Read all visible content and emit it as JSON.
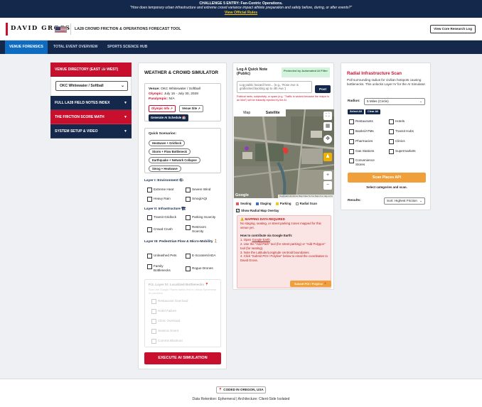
{
  "banner": {
    "line1": "CHALLENGE 5 ENTRY: Fan-Centric Operations.",
    "line2": "\"How does temporary urban infrastructure and extreme crowd variance impact athlete preparation and safety before, during, or after events?\"",
    "link": "View Official Rules"
  },
  "header": {
    "logo": "DAVID GROSS",
    "title": "LA28 CROWD FRICTION & OPERATIONS FORECAST TOOL",
    "research_log": "View Core Research Log"
  },
  "nav": {
    "tabs": [
      "VENUE FORENSICS",
      "TOTAL EVENT OVERVIEW",
      "SPORTS SCIENCE HUB"
    ]
  },
  "left": {
    "directory": "VENUE DIRECTORY (EAST 🇺🇸 WEST)",
    "selected_venue": "OKC Whitewater / Softball",
    "items": [
      "FULL LA28 FIELD NOTES INDEX",
      "THE FRICTION SCORE MATH",
      "SYSTEM SETUP & VIDEO"
    ]
  },
  "weather": {
    "title": "WEATHER & CROWD SIMULATOR",
    "venue_label": "Venue:",
    "venue": "OKC Whitewater / Softball",
    "olympic_label": "Olympic:",
    "olympic": "July 15 - July 30, 2028",
    "para_label": "Paralympic:",
    "para": "N/A",
    "olympic_info": "Olympic Info ↗",
    "venue_site": "Venue Site ↗",
    "gen_schedule": "Generate AI Schedule 📅",
    "quick_label": "Quick Scenarios:",
    "scenarios": [
      "Heatwave + Gridlock",
      "Storm + Flow Bottleneck",
      "Earthquake + Network Collapse",
      "Smog + Heatwave"
    ],
    "layer1": {
      "title": "Layer I: Environment 🌤",
      "items": [
        "Extreme Heat",
        "Severe Wind",
        "Heavy Rain",
        "Smog/AQI"
      ]
    },
    "layer2": {
      "title": "Layer II: Infrastructure 🏗",
      "items": [
        "Transit Gridlock",
        "Parking Scarcity",
        "Crowd Crush",
        "Restroom Scarcity"
      ]
    },
    "layer3": {
      "title": "Layer III: Pedestrian Flow & Micro-Mobility 🚶",
      "items": [
        "Unleashed Pets",
        "E-Scooters/ADA",
        "Family Bottlenecks",
        "Rogue Drones"
      ]
    },
    "layer4": {
      "title": "P.S. Layer IV: Localized Bottlenecks 📍",
      "note": "Scan the Google Places radius first to unlock Ephemeral AI precision.",
      "items": [
        "Restaurant Overload",
        "Hotel Failure",
        "Clinic Overload",
        "Seismic Event",
        "Comms Blackout"
      ]
    },
    "execute": "EXECUTE AI SIMULATION"
  },
  "quicknote": {
    "title": "Log A Quick Note (Public)",
    "protected": "Protected by Automated AI Filter",
    "placeholder": "Log public hazard here... (e.g., 'Rose Ave is gridlocked backing up to 4th Ave.')",
    "post": "Post",
    "notice": "Political rants, subjectivity, or spam (e.g. \"Traffic is wicked because the mayor is an idiot\") will be instantly rejected by the AI."
  },
  "map": {
    "tabs": [
      "Map",
      "Satellite"
    ],
    "google": "Google",
    "footer": "Keyboard shortcuts   Map Data   Terms   Report a map error",
    "legend": [
      {
        "label": "Seating",
        "color": "#e8595d"
      },
      {
        "label": "Staging",
        "color": "#3b6ed1"
      },
      {
        "label": "Parking",
        "color": "#f5c518"
      },
      {
        "label": "Radial Scan",
        "color": "#ffffff"
      }
    ],
    "overlay": "Show Radial Map Overlay"
  },
  "alert": {
    "head": "⚠️ MAPPING DATA REQUIRED",
    "body": "No staging, seating, or street parking zones mapped for this venue yet.",
    "contrib": "How to contribute via Google Earth:",
    "step1a": "1. Open ",
    "step1b": "Google Earth",
    "step1c": ".",
    "step2": "2. Use the \"Add Path\" tool (for street parking) or \"Add Polygon\" tool (for seating).",
    "step3": "3. Note the Latitude/Longitude centroid boundaries.",
    "step4": "4. Click \"Submit POI / Polyline\" below to email the coordinates to David Gross.",
    "submit": "Submit POI / Polyline 📍"
  },
  "radial": {
    "title": "Radial Infrastructure Scan",
    "desc": "Poll surrounding radius for civilian hotspots causing bottlenecks. This unlocks Layer IV for the AI Simulator.",
    "radius_label": "Radius:",
    "radius_value": "5 Miles (Circle)",
    "select_all": "Select All",
    "clear_all": "Clear All",
    "categories": [
      "Restaurants",
      "Hotels",
      "Banks/ATMs",
      "Transit Hubs",
      "Pharmacies",
      "Clinics",
      "Gas Stations",
      "Supermarkets",
      "Convenience Stores"
    ],
    "scan": "Scan Places API",
    "hint": "Select categories and scan.",
    "results_label": "Results:",
    "sort": "Sort: Highest Friction"
  },
  "footer": {
    "badge": "📍 CODED IN OREGON, USA",
    "text": "Data Retention: Ephemeral | Architecture: Client-Side Isolated"
  }
}
